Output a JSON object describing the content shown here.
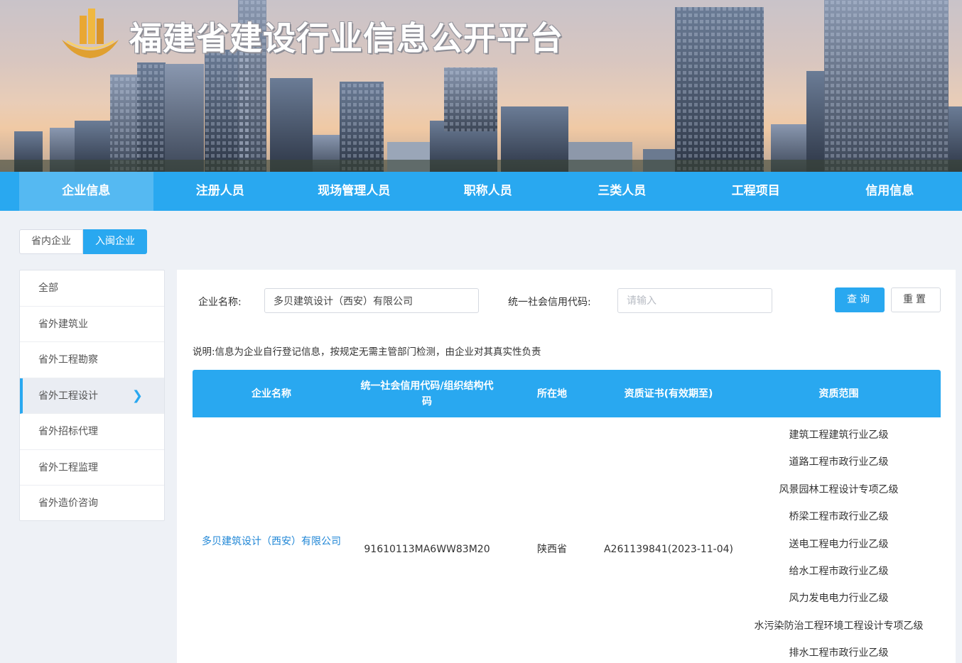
{
  "site": {
    "title": "福建省建设行业信息公开平台"
  },
  "nav": {
    "items": [
      {
        "label": "企业信息",
        "active": true
      },
      {
        "label": "注册人员",
        "active": false
      },
      {
        "label": "现场管理人员",
        "active": false
      },
      {
        "label": "职称人员",
        "active": false
      },
      {
        "label": "三类人员",
        "active": false
      },
      {
        "label": "工程项目",
        "active": false
      },
      {
        "label": "信用信息",
        "active": false
      }
    ]
  },
  "tabs": [
    {
      "label": "省内企业",
      "active": false
    },
    {
      "label": "入闽企业",
      "active": true
    }
  ],
  "sidebar": {
    "items": [
      {
        "label": "全部"
      },
      {
        "label": "省外建筑业"
      },
      {
        "label": "省外工程勘察"
      },
      {
        "label": "省外工程设计",
        "active": true
      },
      {
        "label": "省外招标代理"
      },
      {
        "label": "省外工程监理"
      },
      {
        "label": "省外造价咨询"
      }
    ]
  },
  "search": {
    "name_label": "企业名称:",
    "name_value": "多贝建筑设计（西安）有限公司",
    "code_label": "统一社会信用代码:",
    "code_placeholder": "请输入",
    "query_label": "查询",
    "reset_label": "重置"
  },
  "note": "说明:信息为企业自行登记信息，按规定无需主管部门检测，由企业对其真实性负责",
  "table": {
    "headers": [
      "企业名称",
      "统一社会信用代码/组织结构代码",
      "所在地",
      "资质证书(有效期至)",
      "资质范围"
    ],
    "rows": [
      {
        "name": "多贝建筑设计（西安）有限公司",
        "code": "91610113MA6WW83M20",
        "location": "陕西省",
        "certificate": "A261139841(2023-11-04)",
        "scopes": [
          "建筑工程建筑行业乙级",
          "道路工程市政行业乙级",
          "风景园林工程设计专项乙级",
          "桥梁工程市政行业乙级",
          "送电工程电力行业乙级",
          "给水工程市政行业乙级",
          "风力发电电力行业乙级",
          "水污染防治工程环境工程设计专项乙级",
          "排水工程市政行业乙级"
        ]
      }
    ]
  },
  "colors": {
    "primary": "#29a8f0",
    "nav_active": "#55b9f2",
    "link": "#1f86d6"
  },
  "icons": {
    "logo": "building-logo-icon",
    "chevron": "chevron-right-icon"
  }
}
